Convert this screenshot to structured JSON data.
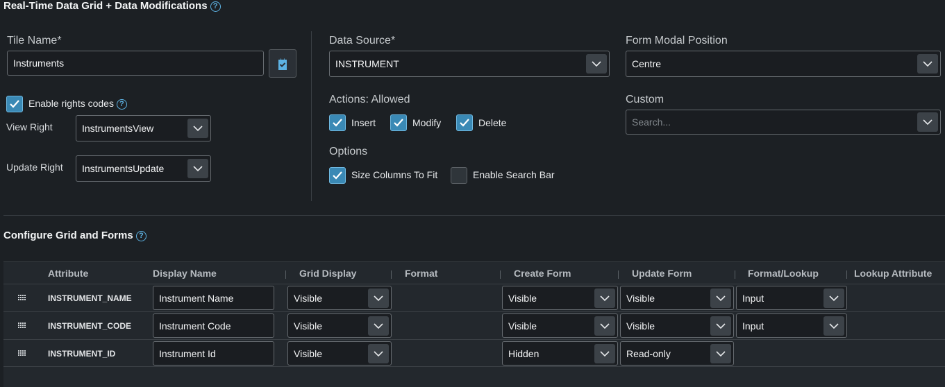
{
  "title": "Real-Time Data Grid + Data Modifications",
  "tile_name": {
    "label": "Tile Name*",
    "value": "Instruments"
  },
  "rights": {
    "enable_label": "Enable rights codes",
    "enabled": true,
    "view_label": "View Right",
    "view_value": "InstrumentsView",
    "update_label": "Update Right",
    "update_value": "InstrumentsUpdate"
  },
  "data_source": {
    "label": "Data Source*",
    "value": "INSTRUMENT"
  },
  "actions": {
    "label": "Actions: Allowed",
    "insert": "Insert",
    "modify": "Modify",
    "delete": "Delete"
  },
  "options": {
    "label": "Options",
    "size_columns": "Size Columns To Fit",
    "search_bar": "Enable Search Bar"
  },
  "form_modal": {
    "label": "Form Modal Position",
    "value": "Centre"
  },
  "custom": {
    "label": "Custom",
    "placeholder": "Search..."
  },
  "configure": {
    "title": "Configure Grid and Forms"
  },
  "grid": {
    "headers": [
      "Attribute",
      "Display Name",
      "Grid Display",
      "Format",
      "Create Form",
      "Update Form",
      "Format/Lookup",
      "Lookup Attribute"
    ],
    "rows": [
      {
        "attribute": "INSTRUMENT_NAME",
        "display_name": "Instrument Name",
        "grid_display": "Visible",
        "create_form": "Visible",
        "update_form": "Visible",
        "format_lookup": "Input"
      },
      {
        "attribute": "INSTRUMENT_CODE",
        "display_name": "Instrument Code",
        "grid_display": "Visible",
        "create_form": "Visible",
        "update_form": "Visible",
        "format_lookup": "Input"
      },
      {
        "attribute": "INSTRUMENT_ID",
        "display_name": "Instrument Id",
        "grid_display": "Visible",
        "create_form": "Hidden",
        "update_form": "Read-only"
      }
    ]
  },
  "colors": {
    "accent": "#3a89b5",
    "background": "#1c2024",
    "help": "#5db2e3"
  },
  "icons": {
    "help": "question-circle-icon",
    "caret": "chevron-down-icon",
    "check": "check-icon",
    "drag": "drag-handle-icon",
    "clipboard": "clipboard-check-icon"
  }
}
